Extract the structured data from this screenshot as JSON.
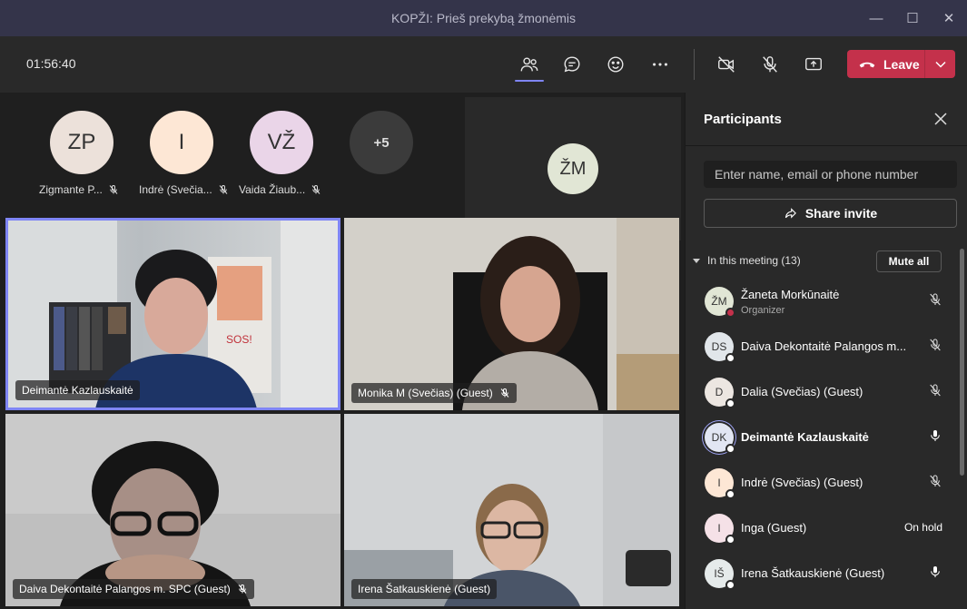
{
  "window": {
    "title": "KOPŽI: Prieš prekybą žmonėmis",
    "controls": [
      "minimize",
      "maximize",
      "close"
    ]
  },
  "toolbar": {
    "timer": "01:56:40",
    "icons": [
      "people-icon",
      "chat-icon",
      "raise-hand-icon",
      "more-icon",
      "camera-off-icon",
      "mic-off-icon",
      "share-screen-icon"
    ],
    "leave_label": "Leave",
    "accent": "#7f85f5",
    "leave_color": "#c4314b"
  },
  "avatar_strip": [
    {
      "initials": "ZP",
      "name": "Zigmante P...",
      "color": "#ece1da",
      "muted": true
    },
    {
      "initials": "I",
      "name": "Indrė (Svečia...",
      "color": "#fde7d5",
      "muted": true
    },
    {
      "initials": "VŽ",
      "name": "Vaida Žiaub...",
      "color": "#ead5e8",
      "muted": true
    }
  ],
  "overflow_count": "+5",
  "self_tile": {
    "initials": "ŽM",
    "color": "#e1e6d5"
  },
  "video_tiles": [
    {
      "name": "Deimantė Kazlauskaitė",
      "muted": false,
      "selected": true
    },
    {
      "name": "Monika M (Svečias) (Guest)",
      "muted": true,
      "selected": false
    },
    {
      "name": "Daiva Dekontaitė Palangos m. SPC (Guest)",
      "muted": true,
      "selected": false
    },
    {
      "name": "Irena Šatkauskienė (Guest)",
      "muted": false,
      "selected": false
    }
  ],
  "panel": {
    "title": "Participants",
    "search_placeholder": "Enter name, email or phone number",
    "share_invite_label": "Share invite",
    "section_label": "In this meeting (13)",
    "mute_all_label": "Mute all",
    "participants": [
      {
        "initials": "ŽM",
        "name": "Žaneta Morkūnaitė",
        "subtitle": "Organizer",
        "color": "#e1e6d5",
        "status": "mic-off",
        "dot": "red",
        "bold": false
      },
      {
        "initials": "DS",
        "name": "Daiva Dekontaitė Palangos m...",
        "subtitle": "",
        "color": "#e1e6ea",
        "status": "mic-off",
        "dot": "white",
        "bold": false
      },
      {
        "initials": "D",
        "name": "Dalia (Svečias) (Guest)",
        "subtitle": "",
        "color": "#ece6e1",
        "status": "mic-off",
        "dot": "white",
        "bold": false
      },
      {
        "initials": "DK",
        "name": "Deimantė Kazlauskaitė",
        "subtitle": "",
        "color": "#e2e6f3",
        "status": "mic-on",
        "dot": "white",
        "bold": true
      },
      {
        "initials": "I",
        "name": "Indrė (Svečias) (Guest)",
        "subtitle": "",
        "color": "#fde7d5",
        "status": "mic-off",
        "dot": "white",
        "bold": false
      },
      {
        "initials": "I",
        "name": "Inga (Guest)",
        "subtitle": "",
        "color": "#f5e1e7",
        "status": "text",
        "status_text": "On hold",
        "dot": "white",
        "bold": false
      },
      {
        "initials": "IŠ",
        "name": "Irena Šatkauskienė (Guest)",
        "subtitle": "",
        "color": "#e5eaea",
        "status": "mic-on",
        "dot": "white",
        "bold": false
      }
    ]
  }
}
